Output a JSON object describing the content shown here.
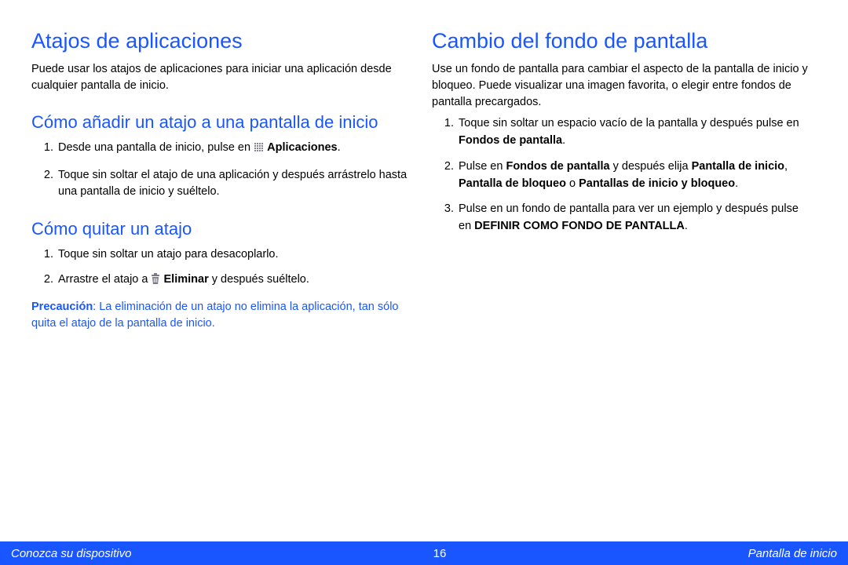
{
  "left": {
    "h1": "Atajos de aplicaciones",
    "intro": "Puede usar los atajos de aplicaciones para iniciar una aplicación desde cualquier pantalla de inicio.",
    "h2a": "Cómo añadir un atajo a una pantalla de inicio",
    "add1_a": "Desde una pantalla de inicio, pulse en ",
    "add1_b": "Aplicaciones",
    "add1_c": ".",
    "add2": "Toque sin soltar el atajo de una aplicación y después arrástrelo hasta una pantalla de inicio y suéltelo.",
    "h2b": "Cómo quitar un atajo",
    "rem1": "Toque sin soltar un atajo para desacoplarlo.",
    "rem2_a": "Arrastre el atajo a ",
    "rem2_b": "Eliminar",
    "rem2_c": " y después suéltelo.",
    "caution_label": "Precaución",
    "caution": ": La eliminación de un atajo no elimina la aplicación, tan sólo quita el atajo de la pantalla de inicio."
  },
  "right": {
    "h1": "Cambio del fondo de pantalla",
    "intro": "Use un fondo de pantalla para cambiar el aspecto de la pantalla de inicio y bloqueo. Puede visualizar una imagen favorita, o elegir entre fondos de pantalla precargados.",
    "s1_a": "Toque sin soltar un espacio vacío de la pantalla y después pulse en ",
    "s1_b": "Fondos de pantalla",
    "s1_c": ".",
    "s2_a": "Pulse en ",
    "s2_b": "Fondos de pantalla",
    "s2_c": " y después elija ",
    "s2_d": "Pantalla de inicio",
    "s2_e": ", ",
    "s2_f": "Pantalla de bloqueo",
    "s2_g": " o ",
    "s2_h": "Pantallas de inicio y bloqueo",
    "s2_i": ".",
    "s3_a": "Pulse en un fondo de pantalla para ver un ejemplo y después pulse en ",
    "s3_b": "DEFINIR COMO FONDO DE PANTALLA",
    "s3_c": "."
  },
  "footer": {
    "left": "Conozca su dispositivo",
    "center": "16",
    "right": "Pantalla de inicio"
  }
}
